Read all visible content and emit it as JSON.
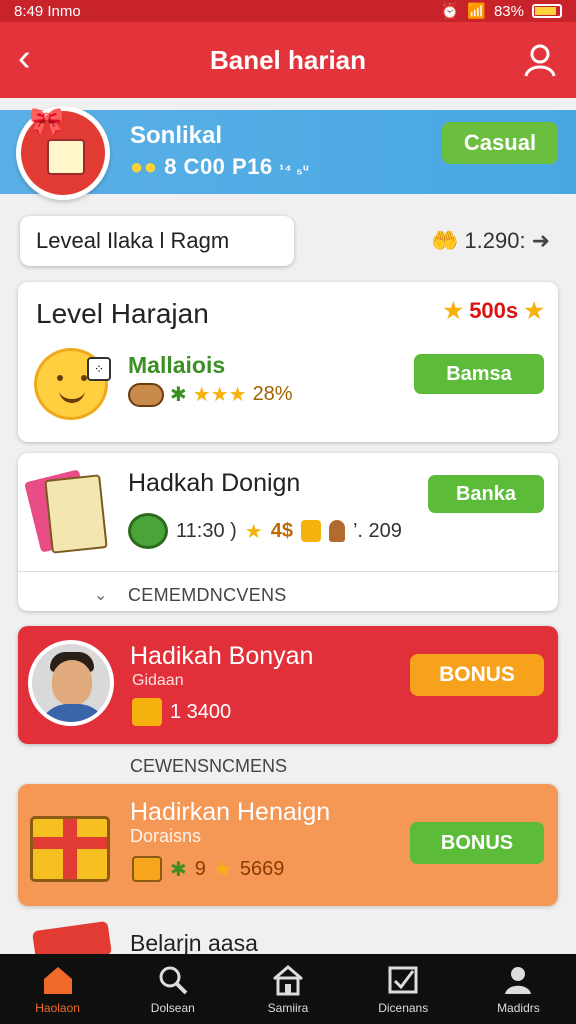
{
  "status": {
    "time": "8:49 Inmo",
    "battery": "83%"
  },
  "appbar": {
    "title": "Banel harian"
  },
  "banner": {
    "name": "Sonlikal",
    "sub": "8 C00 P16",
    "sub_suffix": "¹⁴ ₅ᵘ",
    "button": "Casual"
  },
  "filter": {
    "chip": "Leveal Ilaka l Ragm",
    "points": "1.290:"
  },
  "card1": {
    "title": "Level Harajan",
    "reward": "500s",
    "name": "Mallaiois",
    "percent": "28%",
    "button": "Bamsa"
  },
  "card2": {
    "title": "Hadkah Donign",
    "time": "11:30 )",
    "amount1": "4$",
    "amount2": "’. 209",
    "button": "Banka",
    "footer": "CEMEMDNCVENS"
  },
  "card3": {
    "title": "Hadikah Bonyan",
    "sub": "Gidaan",
    "amount": "1 3400",
    "button": "BONUS"
  },
  "section_label": "CEWENSNCMENS",
  "card4": {
    "title": "Hadirkan Henaign",
    "sub": "Doraisns",
    "count": "9",
    "amount": "5669",
    "button": "BONUS"
  },
  "peek": {
    "title": "Belarjn aasa"
  },
  "nav": [
    {
      "label": "Haolaon",
      "icon": "home-icon",
      "active": true
    },
    {
      "label": "Dolsean",
      "icon": "search-icon",
      "active": false
    },
    {
      "label": "Samiira",
      "icon": "store-icon",
      "active": false
    },
    {
      "label": "Dicenans",
      "icon": "checkbox-icon",
      "active": false
    },
    {
      "label": "Madidrs",
      "icon": "person-icon",
      "active": false
    }
  ],
  "colors": {
    "primary": "#e2343a",
    "banner": "#49a7e3",
    "green": "#5dbb3a",
    "orange": "#f7a21d",
    "card4": "#f59856"
  }
}
